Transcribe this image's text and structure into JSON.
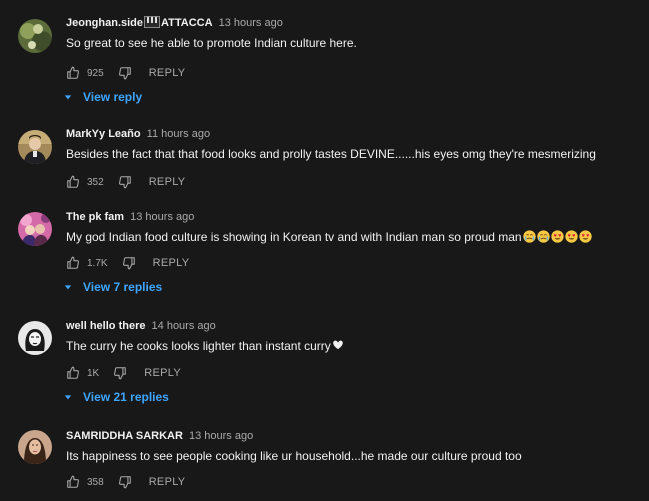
{
  "comments": [
    {
      "author": "Jeonghan.side",
      "author_suffix": "ATTACCA",
      "time": "13 hours ago",
      "text": "So great to see he able to promote Indian culture here.",
      "likes": "925",
      "reply_label": "REPLY",
      "view_replies": "View reply"
    },
    {
      "author": "MarkYy Leaño",
      "time": "11 hours ago",
      "text": "Besides the fact that that food looks and prolly tastes DEVINE......his eyes omg they're mesmerizing",
      "likes": "352",
      "reply_label": "REPLY"
    },
    {
      "author": "The pk fam",
      "time": "13 hours ago",
      "text": "My god Indian food culture is showing in Korean tv and with Indian man so proud man",
      "likes": "1.7K",
      "reply_label": "REPLY",
      "view_replies": "View 7 replies"
    },
    {
      "author": "well hello there",
      "time": "14 hours ago",
      "text": "The curry he cooks looks lighter than instant curry",
      "likes": "1K",
      "reply_label": "REPLY",
      "view_replies": "View 21 replies"
    },
    {
      "author": "SAMRIDDHA SARKAR",
      "time": "13 hours ago",
      "text": "Its happiness to see people cooking like ur household...he made our culture proud too",
      "likes": "358",
      "reply_label": "REPLY"
    }
  ],
  "colors": {
    "background": "#181818",
    "text": "#f1f1f1",
    "secondary": "#aaaaaa",
    "link": "#3ea6ff"
  },
  "icons": [
    "thumb-up-icon",
    "thumb-down-icon",
    "caret-down-icon",
    "musical-keys-icon",
    "crying-face-emoji",
    "heart-eyes-emoji",
    "heart-icon"
  ]
}
